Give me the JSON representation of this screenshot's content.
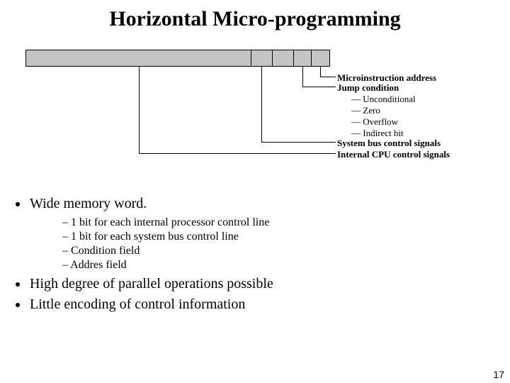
{
  "title": "Horizontal Micro-programming",
  "diagram": {
    "word_dividers_pct": [
      74,
      81,
      88,
      94
    ],
    "labels": {
      "microinstr_addr": "Microinstruction address",
      "jump_cond": "Jump condition",
      "cond_unconditional": "— Unconditional",
      "cond_zero": "— Zero",
      "cond_overflow": "— Overflow",
      "cond_indirect": "— Indirect bit",
      "sys_bus": "System bus control signals",
      "internal_cpu": "Internal CPU control signals"
    }
  },
  "bullets": {
    "b1": "Wide memory word.",
    "b1_sub": [
      "1 bit for each internal processor control line",
      "1 bit for each system bus control line",
      "Condition field",
      "Addres field"
    ],
    "b2": "High degree of parallel operations possible",
    "b3": "Little encoding of control information"
  },
  "page_number": "17"
}
